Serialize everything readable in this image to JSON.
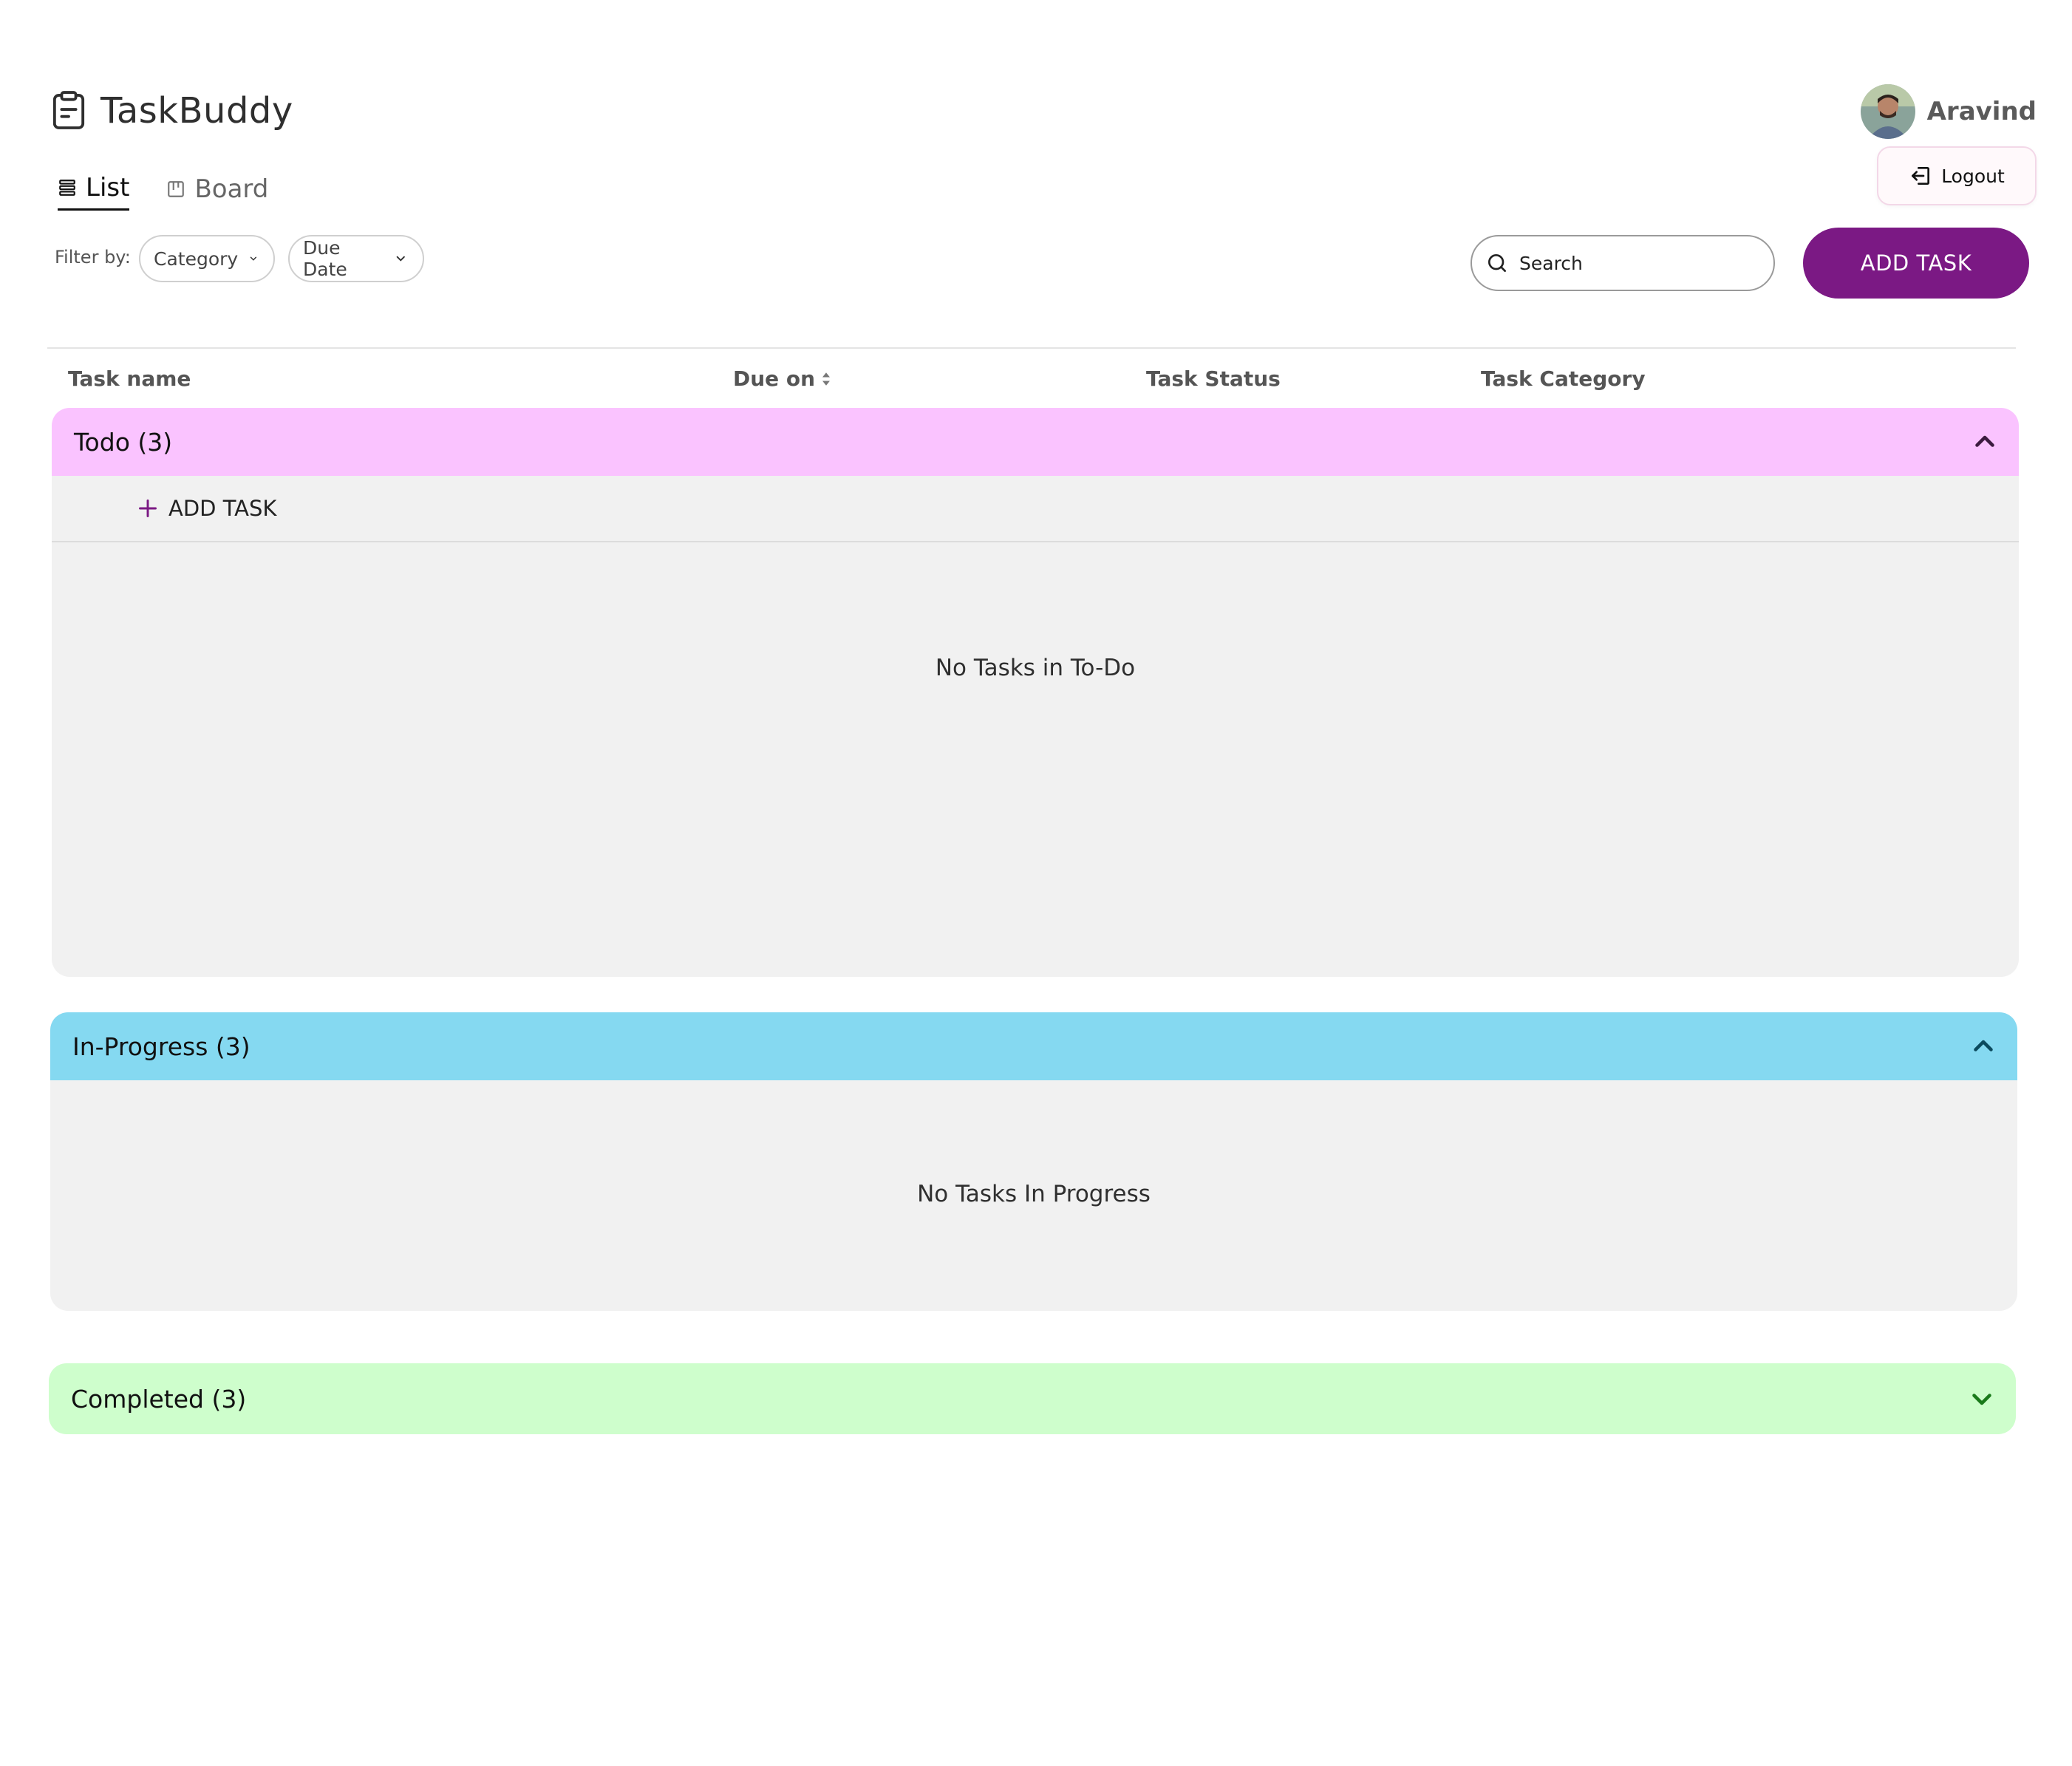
{
  "app": {
    "title": "TaskBuddy",
    "brand_icon": "clipboard-icon"
  },
  "user": {
    "name": "Aravind",
    "logout_label": "Logout"
  },
  "tabs": [
    {
      "label": "List",
      "icon": "list-icon",
      "active": true
    },
    {
      "label": "Board",
      "icon": "board-icon",
      "active": false
    }
  ],
  "filters": {
    "label": "Filter by:",
    "category": "Category",
    "due_date": "Due Date"
  },
  "search": {
    "placeholder": "Search"
  },
  "toolbar": {
    "add_task_label": "ADD TASK"
  },
  "table": {
    "columns": [
      "Task name",
      "Due on",
      "Task Status",
      "Task Category"
    ]
  },
  "sections": {
    "todo": {
      "title": "Todo (3)",
      "add_label": "ADD TASK",
      "empty": "No Tasks in To-Do",
      "color": "#fac3ff"
    },
    "in_progress": {
      "title": "In-Progress (3)",
      "empty": "No Tasks In Progress",
      "color": "#85d9f1"
    },
    "completed": {
      "title": "Completed (3)",
      "color": "#cefecc"
    }
  },
  "colors": {
    "accent": "#7b1984"
  }
}
